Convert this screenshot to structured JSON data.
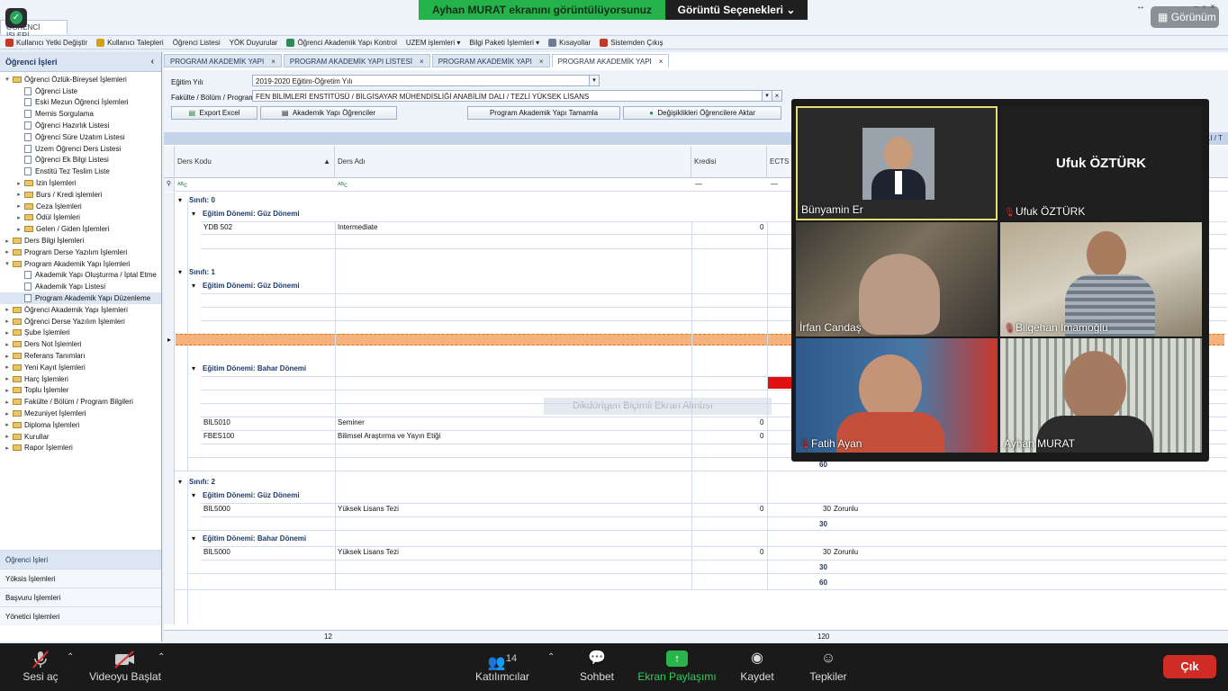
{
  "window": {
    "app_tab": "ÖĞRENCİ İŞLERİ"
  },
  "zoom": {
    "share_banner": "Ayhan MURAT ekranını görüntülüyorsunuz",
    "view_options": "Görüntü Seçenekleri",
    "view_button": "Görünüm",
    "participants_count": "14",
    "controls": {
      "mute": "Sesi aç",
      "video": "Videoyu Başlat",
      "participants": "Katılımcılar",
      "chat": "Sohbet",
      "share": "Ekran Paylaşımı",
      "record": "Kaydet",
      "reactions": "Tepkiler",
      "leave": "Çık"
    },
    "tiles": [
      {
        "name": "Bünyamin Er",
        "muted": false
      },
      {
        "name": "Ufuk ÖZTÜRK",
        "big_name": "Ufuk ÖZTÜRK",
        "muted": true
      },
      {
        "name": "İrfan Candaş",
        "muted": false
      },
      {
        "name": "Bilgehan İmamoğlu",
        "muted": true
      },
      {
        "name": "Fatih Ayan",
        "muted": true
      },
      {
        "name": "Ayhan MURAT",
        "muted": false
      }
    ]
  },
  "toolbar": [
    {
      "label": "Kullanıcı Yetki Değiştir",
      "icon": "user-key-icon",
      "color": "#c0392b"
    },
    {
      "label": "Kullanıcı Talepleri",
      "icon": "requests-icon",
      "color": "#d4a017"
    },
    {
      "label": "Öğrenci Listesi",
      "icon": "",
      "color": ""
    },
    {
      "label": "YÖK Duyurular",
      "icon": "",
      "color": ""
    },
    {
      "label": "Öğrenci Akademik Yapı Kontrol",
      "icon": "control-icon",
      "color": "#2e8b57"
    },
    {
      "label": "UZEM işlemleri ▾",
      "icon": "",
      "color": ""
    },
    {
      "label": "Bilgi Paketi İşlemleri ▾",
      "icon": "",
      "color": ""
    },
    {
      "label": "Kısayollar",
      "icon": "shortcuts-icon",
      "color": "#6b7c93"
    },
    {
      "label": "Sistemden Çıkış",
      "icon": "exit-icon",
      "color": "#c0392b"
    }
  ],
  "left_panel": {
    "title": "Öğrenci İşleri",
    "tree": [
      {
        "label": "Öğrenci Özlük-Bireysel İşlemleri",
        "level": 0,
        "type": "folder",
        "exp": "▾"
      },
      {
        "label": "Öğrenci Liste",
        "level": 1,
        "type": "doc",
        "exp": ""
      },
      {
        "label": "Eski Mezun Öğrenci İşlemleri",
        "level": 1,
        "type": "doc",
        "exp": ""
      },
      {
        "label": "Mernis Sorgulama",
        "level": 1,
        "type": "doc",
        "exp": ""
      },
      {
        "label": "Öğrenci Hazırlık Listesi",
        "level": 1,
        "type": "doc",
        "exp": ""
      },
      {
        "label": "Öğrenci Süre Uzatım Listesi",
        "level": 1,
        "type": "doc",
        "exp": ""
      },
      {
        "label": "Uzem Öğrenci Ders Listesi",
        "level": 1,
        "type": "doc",
        "exp": ""
      },
      {
        "label": "Öğrenci Ek Bilgi Listesi",
        "level": 1,
        "type": "doc",
        "exp": ""
      },
      {
        "label": "Enstitü Tez Teslim Liste",
        "level": 1,
        "type": "doc",
        "exp": ""
      },
      {
        "label": "İzin İşlemleri",
        "level": 1,
        "type": "folder",
        "exp": "▸"
      },
      {
        "label": "Burs / Kredi işlemleri",
        "level": 1,
        "type": "folder",
        "exp": "▸"
      },
      {
        "label": "Ceza İşlemleri",
        "level": 1,
        "type": "folder",
        "exp": "▸"
      },
      {
        "label": "Ödül İşlemleri",
        "level": 1,
        "type": "folder",
        "exp": "▸"
      },
      {
        "label": "Gelen / Giden İşlemleri",
        "level": 1,
        "type": "folder",
        "exp": "▸"
      },
      {
        "label": "Ders Bilgi İşlemleri",
        "level": 0,
        "type": "folder",
        "exp": "▸"
      },
      {
        "label": "Program Derse Yazılım İşlemleri",
        "level": 0,
        "type": "folder",
        "exp": "▸"
      },
      {
        "label": "Program Akademik Yapı İşlemleri",
        "level": 0,
        "type": "folder",
        "exp": "▾"
      },
      {
        "label": "Akademik Yapı Oluşturma / İptal Etme",
        "level": 1,
        "type": "doc",
        "exp": ""
      },
      {
        "label": "Akademik Yapı Listesi",
        "level": 1,
        "type": "doc",
        "exp": ""
      },
      {
        "label": "Program Akademik Yapı Düzenleme",
        "level": 1,
        "type": "doc",
        "exp": "",
        "selected": true
      },
      {
        "label": "Öğrenci Akademik Yapı İşlemleri",
        "level": 0,
        "type": "folder",
        "exp": "▸"
      },
      {
        "label": "Öğrenci Derse Yazılım İşlemleri",
        "level": 0,
        "type": "folder",
        "exp": "▸"
      },
      {
        "label": "Şube İşlemleri",
        "level": 0,
        "type": "folder",
        "exp": "▸"
      },
      {
        "label": "Ders Not İşlemleri",
        "level": 0,
        "type": "folder",
        "exp": "▸"
      },
      {
        "label": "Referans Tanımları",
        "level": 0,
        "type": "folder",
        "exp": "▸"
      },
      {
        "label": "Yeni Kayıt İşlemleri",
        "level": 0,
        "type": "folder",
        "exp": "▸"
      },
      {
        "label": "Harç İşlemleri",
        "level": 0,
        "type": "folder",
        "exp": "▸"
      },
      {
        "label": "Toplu İşlemler",
        "level": 0,
        "type": "folder",
        "exp": "▸"
      },
      {
        "label": "Fakülte / Bölüm / Program Bilgileri",
        "level": 0,
        "type": "folder",
        "exp": "▸"
      },
      {
        "label": "Mezuniyet İşlemleri",
        "level": 0,
        "type": "folder",
        "exp": "▸"
      },
      {
        "label": "Diploma İşlemleri",
        "level": 0,
        "type": "folder",
        "exp": "▸"
      },
      {
        "label": "Kurullar",
        "level": 0,
        "type": "folder",
        "exp": "▸"
      },
      {
        "label": "Rapor İşlemleri",
        "level": 0,
        "type": "folder",
        "exp": "▸"
      }
    ],
    "bottom": [
      "Öğrenci İşleri",
      "Yöksis İşlemleri",
      "Başvuru İşlemleri",
      "Yönetici İşlemleri"
    ]
  },
  "tabs": [
    {
      "label": "PROGRAM AKADEMİK YAPI",
      "active": false
    },
    {
      "label": "PROGRAM AKADEMİK YAPI LİSTESİ",
      "active": false
    },
    {
      "label": "PROGRAM AKADEMİK YAPI",
      "active": false
    },
    {
      "label": "PROGRAM AKADEMİK YAPI",
      "active": true
    }
  ],
  "form": {
    "year_label": "Eğitim Yılı",
    "year_value": "2019-2020 Eğitim-Öğretim Yılı",
    "program_label": "Fakülte / Bölüm / Program",
    "program_value": "FEN BİLİMLERİ ENSTİTÜSÜ / BİLGİSAYAR MÜHENDİSLİĞİ ANABİLİM DALI / TEZLİ YÜKSEK LİSANS",
    "btn_export": "Export Excel",
    "btn_students": "Akademik Yapı Öğrenciler",
    "btn_complete": "Program Akademik Yapı Tamamla",
    "btn_transfer": "Değişiklikleri Öğrencilere Aktar"
  },
  "grid": {
    "band": "( 2019 )FEN BİLİMLERİ ENSTİTÜSÜ / BİLGİSAYAR MÜHENDİSLİĞİ ANABİLİM DALI / T",
    "headers": {
      "code": "Ders Kodu",
      "name": "Ders Adı",
      "credit": "Kredisi",
      "ects": "ECTS"
    },
    "filter_dash": "—",
    "snip_ghost": "Dikdörtgen Biçimli Ekran Alıntısı",
    "groups": {
      "s0": "Sınıfı: 0",
      "s0_fall": "Eğitim Dönemi: Güz Dönemi",
      "s1": "Sınıfı: 1",
      "s1_fall": "Eğitim Dönemi: Güz Dönemi",
      "s1_spring": "Eğitim Dönemi: Bahar Dönemi",
      "s2": "Sınıfı: 2",
      "s2_fall": "Eğitim Dönemi: Güz Dönemi",
      "s2_spring": "Eğitim Dönemi: Bahar Dönemi"
    },
    "rows": {
      "r1": {
        "code": "YDB 502",
        "name": "Intermediate",
        "credit": "0"
      },
      "r2": {
        "code": "BIL5010",
        "name": "Seminer",
        "credit": "0"
      },
      "r3": {
        "code": "FBES100",
        "name": "Bilimsel Araştırma ve Yayın Etiği",
        "credit": "0"
      },
      "r4": {
        "code": "BIL5000",
        "name": "Yüksek Lisans Tezi",
        "credit": "0",
        "ects": "30",
        "type": "Zorunlu"
      },
      "r5": {
        "code": "BIL5000",
        "name": "Yüksek Lisans Tezi",
        "credit": "0",
        "ects": "30",
        "type": "Zorunlu"
      }
    },
    "sums": {
      "s1_total": "60",
      "s2_fall": "30",
      "s2_spring": "30",
      "s2_total": "60"
    },
    "footer": {
      "count": "12",
      "ects_total": "120"
    }
  }
}
